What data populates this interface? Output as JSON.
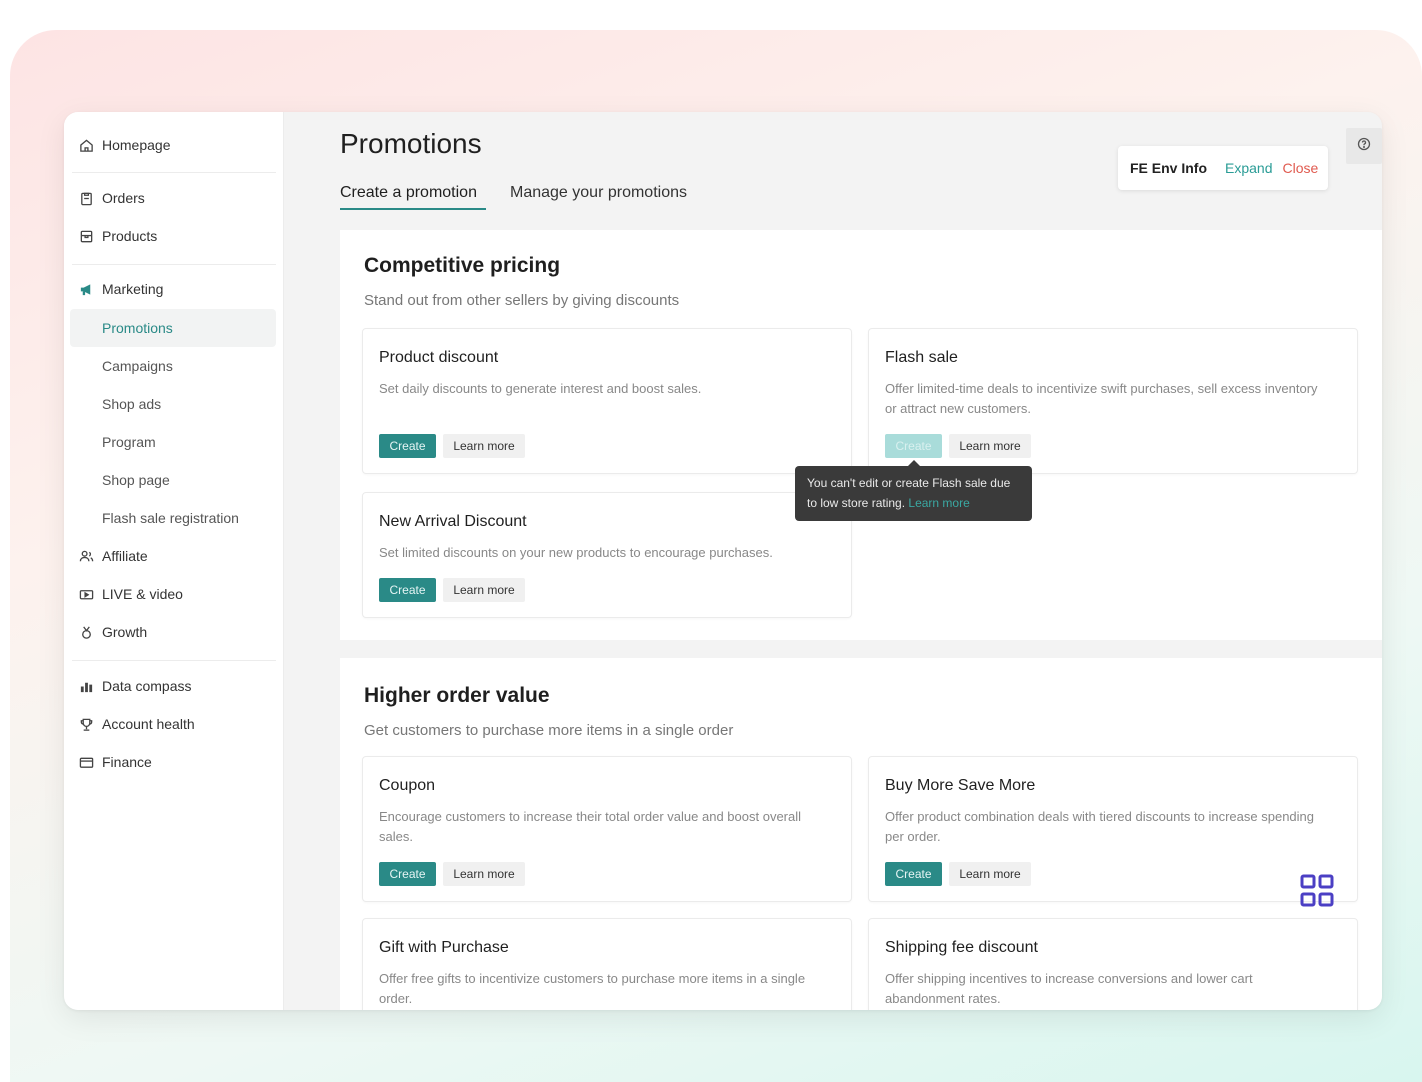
{
  "sidebar": {
    "items": [
      {
        "label": "Homepage",
        "icon": "home-icon"
      },
      {
        "label": "Orders",
        "icon": "clipboard-icon"
      },
      {
        "label": "Products",
        "icon": "box-icon"
      },
      {
        "label": "Marketing",
        "icon": "megaphone-icon"
      },
      {
        "label": "Affiliate",
        "icon": "people-icon"
      },
      {
        "label": "LIVE & video",
        "icon": "video-icon"
      },
      {
        "label": "Growth",
        "icon": "medal-icon"
      },
      {
        "label": "Data compass",
        "icon": "chart-icon"
      },
      {
        "label": "Account health",
        "icon": "trophy-icon"
      },
      {
        "label": "Finance",
        "icon": "card-icon"
      }
    ],
    "marketing_sub": [
      {
        "label": "Promotions",
        "active": true
      },
      {
        "label": "Campaigns"
      },
      {
        "label": "Shop ads"
      },
      {
        "label": "Program"
      },
      {
        "label": "Shop page"
      },
      {
        "label": "Flash sale registration"
      }
    ]
  },
  "page": {
    "title": "Promotions",
    "tabs": [
      "Create a promotion",
      "Manage your promotions"
    ]
  },
  "env": {
    "label": "FE Env Info",
    "expand": "Expand",
    "close": "Close"
  },
  "sections": [
    {
      "title": "Competitive pricing",
      "subtitle": "Stand out from other sellers by giving discounts",
      "cards": [
        {
          "title": "Product discount",
          "desc": "Set daily discounts to generate interest and boost sales.",
          "create": "Create",
          "learn": "Learn more"
        },
        {
          "title": "Flash sale",
          "desc": "Offer limited-time deals to incentivize swift purchases, sell excess inventory or attract new customers.",
          "create": "Create",
          "learn": "Learn more"
        },
        {
          "title": "New Arrival Discount",
          "desc": "Set limited discounts on your new products to encourage purchases.",
          "create": "Create",
          "learn": "Learn more"
        }
      ]
    },
    {
      "title": "Higher order value",
      "subtitle": "Get customers to purchase more items in a single order",
      "cards": [
        {
          "title": "Coupon",
          "desc": "Encourage customers to increase their total order value and boost overall sales.",
          "create": "Create",
          "learn": "Learn more"
        },
        {
          "title": "Buy More Save More",
          "desc": "Offer product combination deals with tiered discounts to increase spending per order.",
          "create": "Create",
          "learn": "Learn more"
        },
        {
          "title": "Gift with Purchase",
          "desc": "Offer free gifts to incentivize customers to purchase more items in a single order."
        },
        {
          "title": "Shipping fee discount",
          "desc": "Offer shipping incentives to increase conversions and lower cart abandonment rates."
        }
      ]
    }
  ],
  "tooltip": {
    "text": "You can't edit or create Flash sale due to low store rating.",
    "link": "Learn more"
  },
  "colors": {
    "accent": "#2a8a87",
    "expand": "#2a9c96",
    "close": "#e05a4f",
    "grid_icon": "#4b3fc4"
  }
}
